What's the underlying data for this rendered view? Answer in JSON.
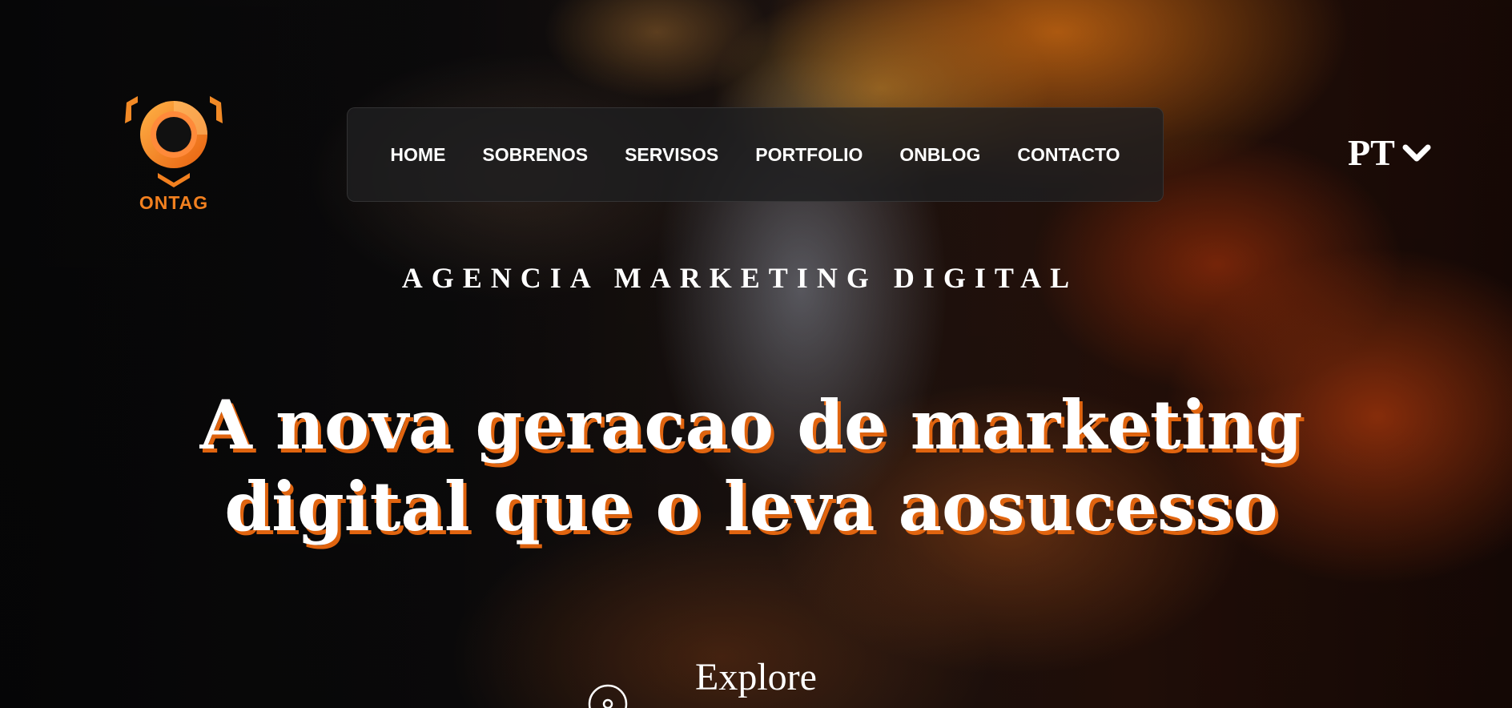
{
  "brand": {
    "name": "ONTAG",
    "accent": "#f2801f",
    "logo_icon": "ontag-logo-icon"
  },
  "nav": {
    "items": [
      {
        "label": "HOME"
      },
      {
        "label": "SOBRENOS"
      },
      {
        "label": "SERVISOS"
      },
      {
        "label": "PORTFOLIO"
      },
      {
        "label": "ONBLOG"
      },
      {
        "label": "CONTACTO"
      }
    ]
  },
  "language": {
    "selected": "PT",
    "icon": "chevron-down-icon"
  },
  "hero": {
    "kicker": "AGENCIA MARKETING DIGITAL",
    "headline_line1": "A nova geracao de marketing",
    "headline_line2": "digital que o leva aosucesso",
    "headline_shadow_color": "#e0640f",
    "explore_label": "Explore",
    "scroll_icon": "scroll-down-icon"
  }
}
